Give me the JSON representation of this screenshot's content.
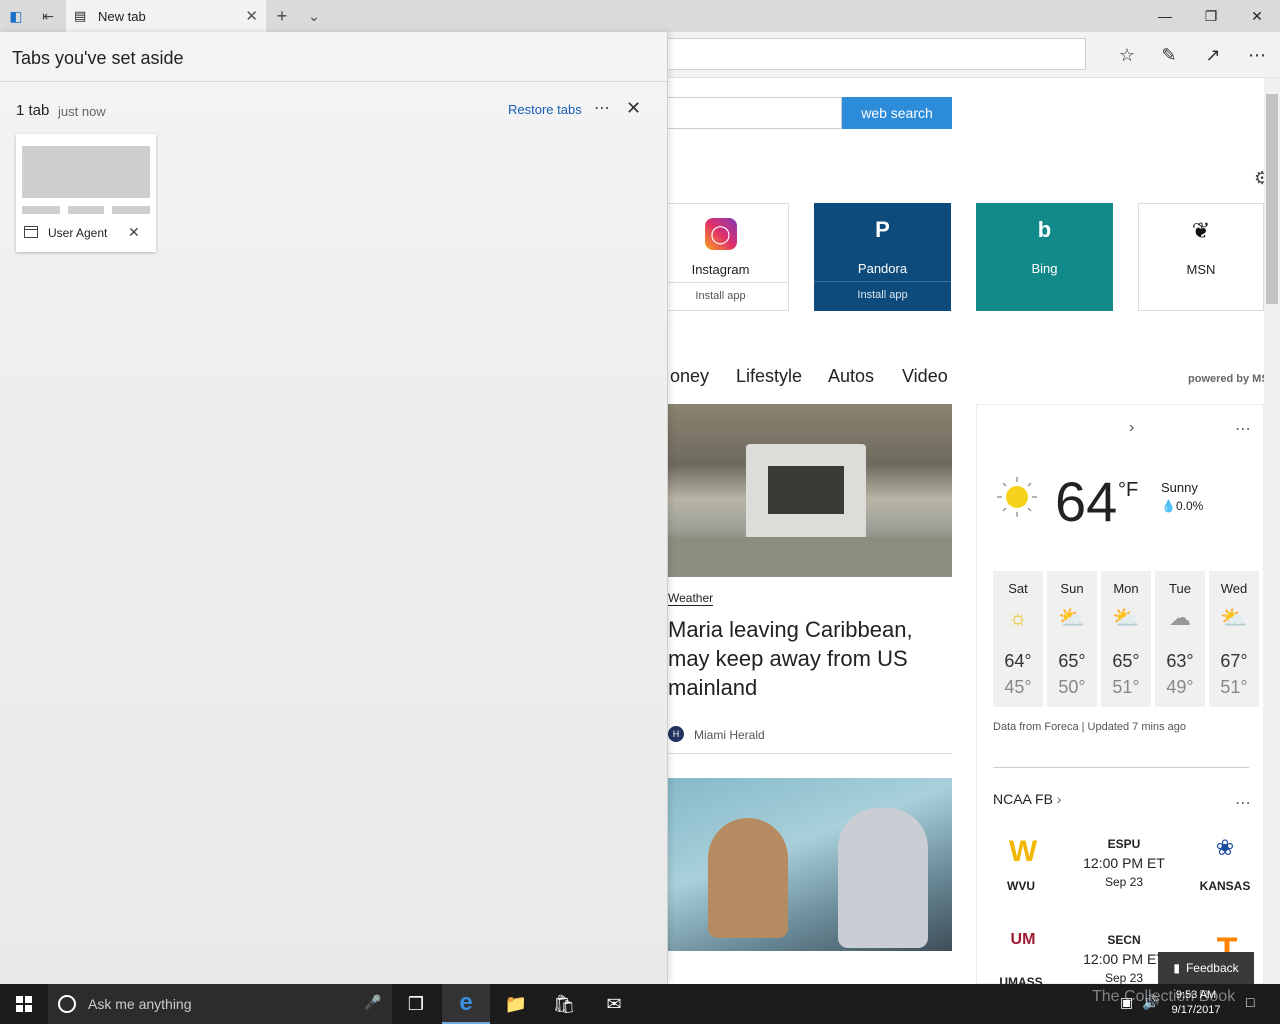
{
  "browser": {
    "tab_title": "New tab",
    "search_button": "web search"
  },
  "tiles": [
    {
      "name": "Instagram",
      "sub": "Install app"
    },
    {
      "name": "Pandora",
      "sub": "Install app"
    },
    {
      "name": "Bing",
      "sub": ""
    },
    {
      "name": "MSN",
      "sub": ""
    }
  ],
  "nav": {
    "items": [
      "oney",
      "Lifestyle",
      "Autos",
      "Video"
    ],
    "powered": "powered by MS"
  },
  "news": {
    "category": "Weather",
    "headline": "Maria leaving Caribbean, may keep away from US mainland",
    "source": "Miami Herald"
  },
  "weather": {
    "temp": "64",
    "unit": "°F",
    "condition": "Sunny",
    "precip": "0.0%",
    "days": [
      {
        "name": "Sat",
        "hi": "64°",
        "lo": "45°",
        "icon": "sun-icon"
      },
      {
        "name": "Sun",
        "hi": "65°",
        "lo": "50°",
        "icon": "partly-cloudy-icon"
      },
      {
        "name": "Mon",
        "hi": "65°",
        "lo": "51°",
        "icon": "partly-cloudy-icon"
      },
      {
        "name": "Tue",
        "hi": "63°",
        "lo": "49°",
        "icon": "cloud-icon"
      },
      {
        "name": "Wed",
        "hi": "67°",
        "lo": "51°",
        "icon": "partly-cloudy-icon"
      }
    ],
    "source": "Data from Foreca | Updated 7 mins ago"
  },
  "sports": {
    "title": "NCAA FB",
    "games": [
      {
        "home": "WVU",
        "away": "KANSAS",
        "network": "ESPU",
        "time": "12:00 PM ET",
        "date": "Sep 23"
      },
      {
        "home": "UMASS",
        "away": "",
        "network": "SECN",
        "time": "12:00 PM ET",
        "date": "Sep 23"
      }
    ]
  },
  "feedback": "Feedback",
  "panel": {
    "title": "Tabs you've set aside",
    "count": "1 tab",
    "when": "just now",
    "restore": "Restore tabs",
    "tab_label": "User Agent"
  },
  "taskbar": {
    "search_placeholder": "Ask me anything",
    "time": "9:53 AM",
    "date": "9/17/2017",
    "watermark": "The Collection Book"
  },
  "colors": {
    "accent": "#2d8cda",
    "pandora": "#0d4b7c",
    "bing": "#138a8a"
  }
}
